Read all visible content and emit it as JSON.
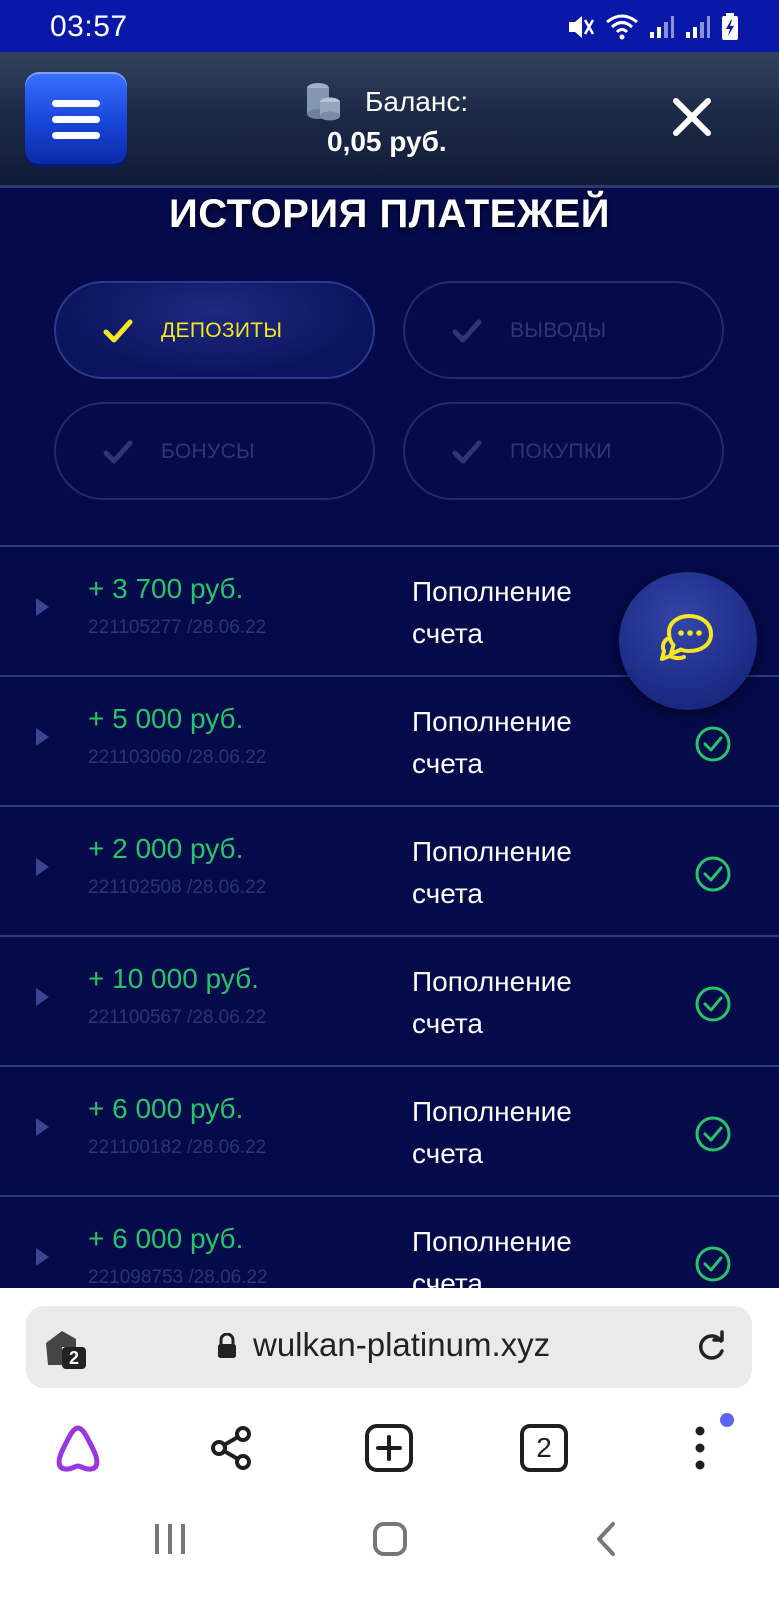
{
  "status_bar": {
    "time": "03:57"
  },
  "header": {
    "balance_label": "Баланс:",
    "balance_value": "0,05 руб."
  },
  "page_title": "ИСТОРИЯ ПЛАТЕЖЕЙ",
  "filters": [
    {
      "label": "ДЕПОЗИТЫ",
      "active": true
    },
    {
      "label": "ВЫВОДЫ",
      "active": false
    },
    {
      "label": "БОНУСЫ",
      "active": false
    },
    {
      "label": "ПОКУПКИ",
      "active": false
    }
  ],
  "transactions": [
    {
      "amount": "+ 3 700 руб.",
      "id_date": "221105277 /28.06.22",
      "description": "Пополнение счета"
    },
    {
      "amount": "+ 5 000 руб.",
      "id_date": "221103060 /28.06.22",
      "description": "Пополнение счета"
    },
    {
      "amount": "+ 2 000 руб.",
      "id_date": "221102508 /28.06.22",
      "description": "Пополнение счета"
    },
    {
      "amount": "+ 10 000 руб.",
      "id_date": "221100567 /28.06.22",
      "description": "Пополнение счета"
    },
    {
      "amount": "+ 6 000 руб.",
      "id_date": "221100182 /28.06.22",
      "description": "Пополнение счета"
    },
    {
      "amount": "+ 6 000 руб.",
      "id_date": "221098753 /28.06.22",
      "description": "Пополнение счета"
    }
  ],
  "browser": {
    "url": "wulkan-platinum.xyz",
    "private_tabs_count": "2",
    "tabs_count": "2"
  },
  "colors": {
    "accent_yellow": "#f5e623",
    "amount_green": "#27c46a",
    "background": "#050a4a",
    "status_bar": "#0a18a8"
  }
}
